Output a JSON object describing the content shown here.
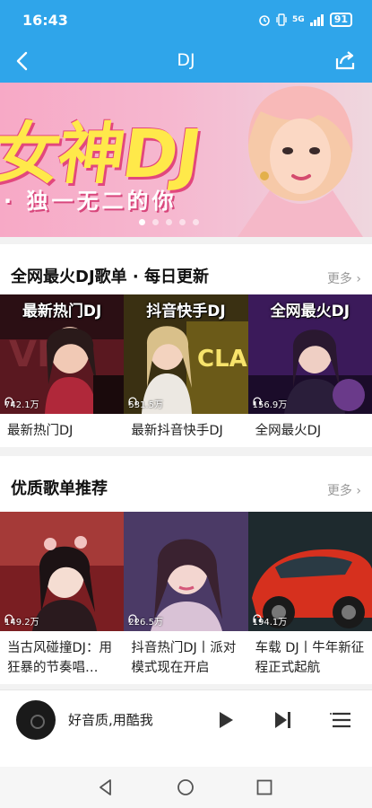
{
  "status_bar": {
    "time": "16:43",
    "network": "5G",
    "battery": "91"
  },
  "app_bar": {
    "title": "DJ",
    "back_icon": "chevron-left-icon",
    "share_icon": "share-icon"
  },
  "banner": {
    "title": "女神DJ",
    "subtitle": "· 独一无二的你",
    "dots_count": 5,
    "active_dot": 0
  },
  "section1": {
    "title": "全网最火DJ歌单 · 每日更新",
    "more": "更多 ›",
    "cards": [
      {
        "cover_label": "最新热门DJ",
        "plays": "742.1万",
        "name": "最新热门DJ"
      },
      {
        "cover_label": "抖音快手DJ",
        "plays": "531.5万",
        "name": "最新抖音快手DJ"
      },
      {
        "cover_label": "全网最火DJ",
        "plays": "156.9万",
        "name": "全网最火DJ"
      }
    ]
  },
  "section2": {
    "title": "优质歌单推荐",
    "more": "更多 ›",
    "cards": [
      {
        "plays": "149.2万",
        "name": "当古风碰撞DJ：用狂暴的节奏唱…"
      },
      {
        "plays": "226.5万",
        "name": "抖音热门DJ丨派对模式现在开启"
      },
      {
        "plays": "194.1万",
        "name": "车载 DJ丨牛年新征程正式起航"
      }
    ]
  },
  "player": {
    "text": "好音质,用酷我"
  },
  "colors": {
    "accent": "#2fa5ea",
    "banner_title": "#ffe94a",
    "banner_pink": "#e2477d"
  }
}
